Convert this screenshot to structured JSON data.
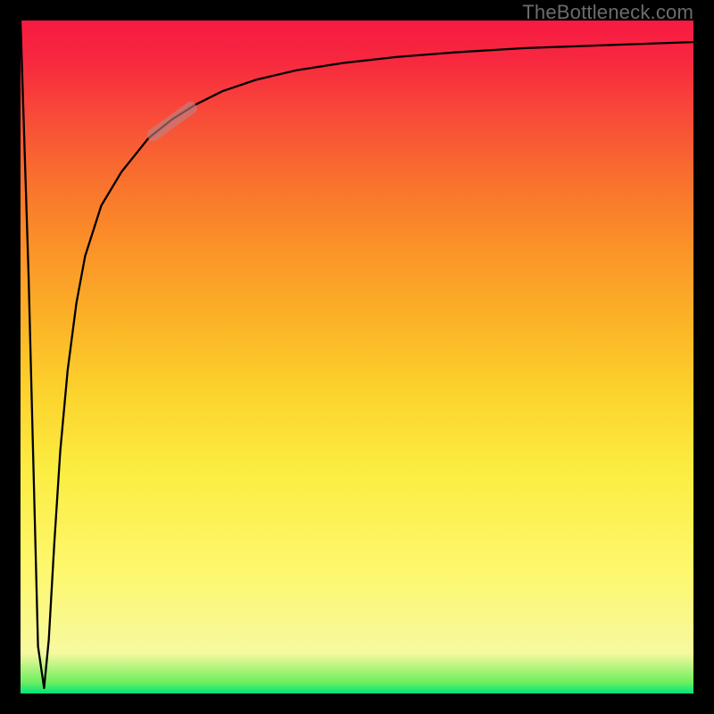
{
  "watermark": "TheBottleneck.com",
  "chart_data": {
    "type": "line",
    "title": "",
    "xlabel": "",
    "ylabel": "",
    "xlim": [
      0,
      100
    ],
    "ylim": [
      0,
      100
    ],
    "grid": false,
    "series": [
      {
        "name": "bottleneck-curve",
        "x": [
          0.0,
          1.2,
          2.6,
          3.5,
          4.2,
          5.0,
          5.9,
          7.0,
          8.3,
          9.6,
          12.0,
          15.0,
          19.0,
          22.5,
          26.0,
          30.0,
          35.0,
          41.0,
          48.0,
          56.0,
          65.0,
          75.0,
          86.0,
          100.0
        ],
        "y": [
          100.0,
          62.0,
          7.0,
          0.8,
          8.0,
          22.0,
          36.0,
          48.0,
          58.0,
          65.0,
          72.5,
          77.5,
          82.5,
          85.3,
          87.5,
          89.5,
          91.2,
          92.6,
          93.7,
          94.6,
          95.3,
          95.9,
          96.3,
          96.8
        ]
      }
    ],
    "highlight_segment": {
      "x_start": 19.0,
      "x_end": 26.0
    },
    "background": "green-to-red vertical gradient"
  },
  "colors": {
    "curve": "#000000",
    "frame": "#000000",
    "marker": "rgba(190,130,130,0.62)"
  }
}
